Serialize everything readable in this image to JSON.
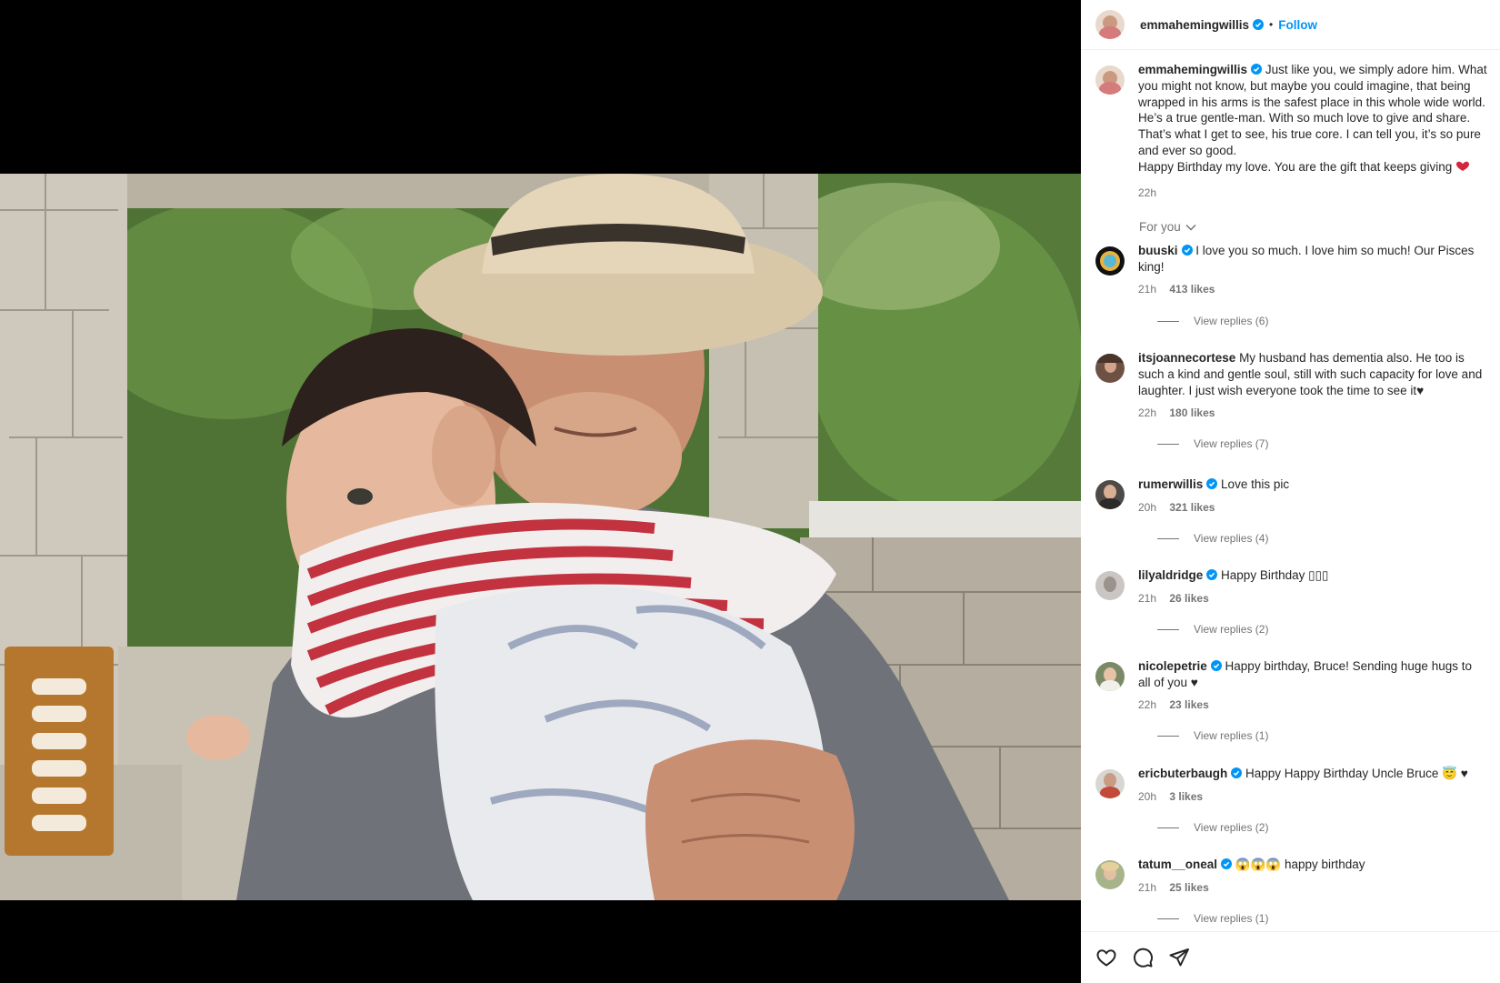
{
  "post": {
    "author": "emmahemingwillis",
    "dot": "•",
    "follow_label": "Follow",
    "caption_lines": [
      "Just like you, we simply adore him. What",
      "you might not know, but maybe you could imagine, that being",
      "wrapped in his arms is the safest place in this whole wide world.",
      "He’s a true gentle-man. With so much love to give and share.",
      "That’s what I get to see, his true core. I can tell you, it’s so pure",
      "and ever so good.",
      "Happy Birthday my love. You are the gift that keeps giving"
    ],
    "caption_time": "22h"
  },
  "comments_filter": "For you",
  "comments": [
    {
      "user": "buuski",
      "lines": [
        "I love you so much. I love him so much! Our Pisces",
        "king!"
      ],
      "time": "21h",
      "likes": "413 likes",
      "replies": "View replies (6)"
    },
    {
      "user": "itsjoannecortese",
      "lines": [
        "My husband has dementia also. He too is",
        "such a kind and gentle soul, still with such capacity for love and",
        "laughter. I just wish everyone took the time to see it♥"
      ],
      "time": "22h",
      "likes": "180 likes",
      "replies": "View replies (7)"
    },
    {
      "user": "rumerwillis",
      "lines": [
        "Love this pic"
      ],
      "time": "20h",
      "likes": "321 likes",
      "replies": "View replies (4)"
    },
    {
      "user": "lilyaldridge",
      "lines": [
        "Happy Birthday ▯▯▯"
      ],
      "time": "21h",
      "likes": "26 likes",
      "replies": "View replies (2)"
    },
    {
      "user": "nicolepetrie",
      "lines": [
        "Happy birthday, Bruce! Sending huge hugs to",
        "all of you ♥"
      ],
      "time": "22h",
      "likes": "23 likes",
      "replies": "View replies (1)"
    },
    {
      "user": "ericbuterbaugh",
      "lines": [
        "Happy Happy Birthday Uncle Bruce 😇 ♥"
      ],
      "time": "20h",
      "likes": "3 likes",
      "replies": "View replies (2)"
    },
    {
      "user": "tatum__oneal",
      "lines": [
        "😱😱😱 happy birthday"
      ],
      "time": "21h",
      "likes": "25 likes",
      "replies": "View replies (1)"
    }
  ],
  "colors": {
    "accent": "#0095f6",
    "verified": "#0095f6",
    "muted": "#737373",
    "text": "#262626"
  },
  "icons": [
    "heart-icon",
    "comment-icon",
    "share-icon"
  ]
}
